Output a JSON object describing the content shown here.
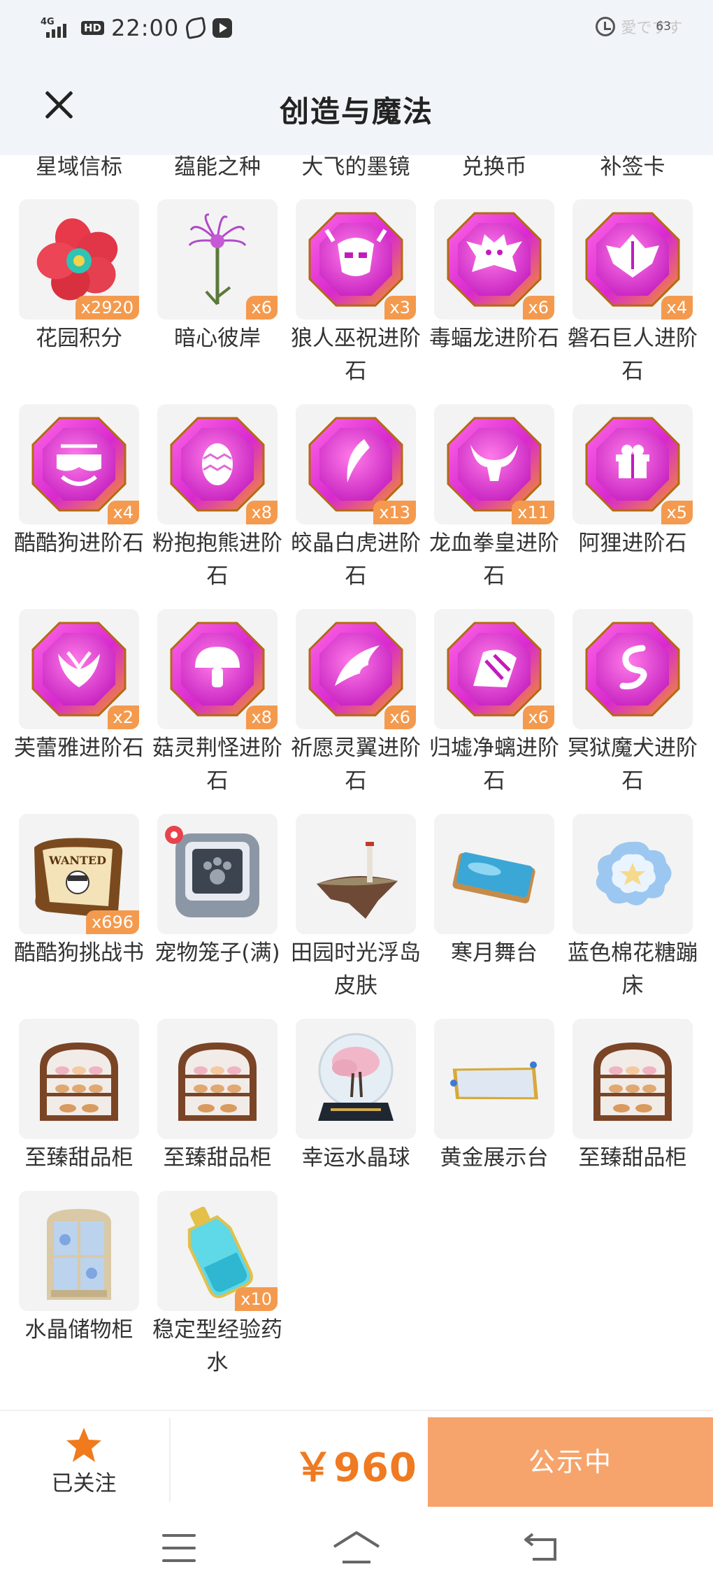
{
  "status_bar": {
    "network": "4G",
    "hd": "HD",
    "time": "22:00",
    "right_text": "愛ですす",
    "battery": "63"
  },
  "header": {
    "title": "创造与魔法",
    "close_icon": "close-icon"
  },
  "top_row": [
    "星域信标",
    "蕴能之种",
    "大飞的墨镜",
    "兑换币",
    "补签卡"
  ],
  "items": [
    {
      "name": "花园积分",
      "count": "x2920",
      "icon": "flower-icon"
    },
    {
      "name": "暗心彼岸",
      "count": "x6",
      "icon": "spider-lily-icon"
    },
    {
      "name": "狼人巫祝进阶石",
      "count": "x3",
      "icon": "gem-icon",
      "emblem": "mask"
    },
    {
      "name": "毒蝠龙进阶石",
      "count": "x6",
      "icon": "gem-icon",
      "emblem": "bat"
    },
    {
      "name": "磐石巨人进阶石",
      "count": "x4",
      "icon": "gem-icon",
      "emblem": "rock"
    },
    {
      "name": "酷酷狗进阶石",
      "count": "x4",
      "icon": "gem-icon",
      "emblem": "goggles"
    },
    {
      "name": "粉抱抱熊进阶石",
      "count": "x8",
      "icon": "gem-icon",
      "emblem": "egg"
    },
    {
      "name": "皎晶白虎进阶石",
      "count": "x13",
      "icon": "gem-icon",
      "emblem": "claw"
    },
    {
      "name": "龙血拳皇进阶石",
      "count": "x11",
      "icon": "gem-icon",
      "emblem": "horns"
    },
    {
      "name": "阿狸进阶石",
      "count": "x5",
      "icon": "gem-icon",
      "emblem": "gift"
    },
    {
      "name": "芙蕾雅进阶石",
      "count": "x2",
      "icon": "gem-icon",
      "emblem": "wings"
    },
    {
      "name": "菇灵荆怪进阶石",
      "count": "x8",
      "icon": "gem-icon",
      "emblem": "mushroom"
    },
    {
      "name": "祈愿灵翼进阶石",
      "count": "x6",
      "icon": "gem-icon",
      "emblem": "feather"
    },
    {
      "name": "归墟净螭进阶石",
      "count": "x6",
      "icon": "gem-icon",
      "emblem": "fin"
    },
    {
      "name": "冥狱魔犬进阶石",
      "count": "",
      "icon": "gem-icon",
      "emblem": "swirl"
    },
    {
      "name": "酷酷狗挑战书",
      "count": "x696",
      "icon": "wanted-scroll-icon",
      "scroll_text": "WANTED"
    },
    {
      "name": "宠物笼子(满)",
      "count": "",
      "icon": "pet-cage-icon"
    },
    {
      "name": "田园时光浮岛皮肤",
      "count": "",
      "icon": "floating-island-icon"
    },
    {
      "name": "寒月舞台",
      "count": "",
      "icon": "ice-stage-icon"
    },
    {
      "name": "蓝色棉花糖蹦床",
      "count": "",
      "icon": "cloud-trampoline-icon"
    },
    {
      "name": "至臻甜品柜",
      "count": "",
      "icon": "dessert-cabinet-icon"
    },
    {
      "name": "至臻甜品柜",
      "count": "",
      "icon": "dessert-cabinet-icon"
    },
    {
      "name": "幸运水晶球",
      "count": "",
      "icon": "crystal-ball-icon"
    },
    {
      "name": "黄金展示台",
      "count": "",
      "icon": "golden-platform-icon"
    },
    {
      "name": "至臻甜品柜",
      "count": "",
      "icon": "dessert-cabinet-icon"
    },
    {
      "name": "水晶储物柜",
      "count": "",
      "icon": "crystal-cabinet-icon"
    },
    {
      "name": "稳定型经验药水",
      "count": "x10",
      "icon": "exp-potion-icon"
    }
  ],
  "bottom_bar": {
    "follow_label": "已关注",
    "price": "￥960",
    "status_button": "公示中"
  },
  "colors": {
    "accent": "#ef7a21",
    "badge": "#f49a4e",
    "status_button": "#f6a46b",
    "header_bg": "#f1f5f9"
  }
}
